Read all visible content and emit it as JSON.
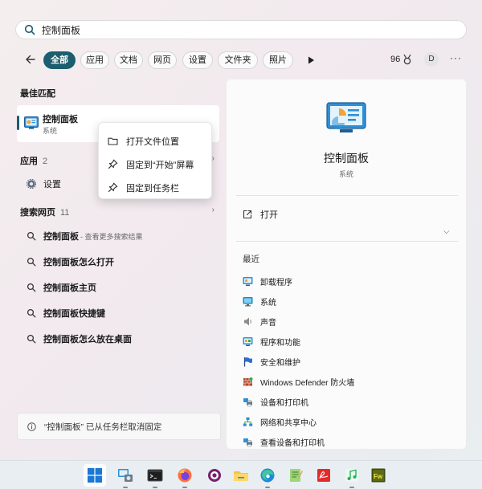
{
  "search": {
    "value": "控制面板"
  },
  "filters": {
    "tabs": [
      "全部",
      "应用",
      "文档",
      "网页",
      "设置",
      "文件夹",
      "照片"
    ],
    "points": "96",
    "avatar_letter": "D",
    "more": "···"
  },
  "best_match": {
    "section": "最佳匹配",
    "title": "控制面板",
    "subtitle": "系统"
  },
  "apps": {
    "section": "应用",
    "count": "2",
    "items": [
      "设置"
    ]
  },
  "web": {
    "section": "搜索网页",
    "count": "11",
    "first_query": "控制面板",
    "first_hint": " - 查看更多搜索结果",
    "suggestions": [
      "控制面板怎么打开",
      "控制面板主页",
      "控制面板快捷键",
      "控制面板怎么放在桌面"
    ]
  },
  "context_menu": {
    "items": [
      "打开文件位置",
      "固定到“开始”屏幕",
      "固定到任务栏"
    ]
  },
  "toast": {
    "text": "“控制面板” 已从任务栏取消固定"
  },
  "detail": {
    "title": "控制面板",
    "subtitle": "系统",
    "open_label": "打开",
    "recent_label": "最近",
    "recent_items": [
      {
        "label": "卸载程序",
        "icon": "control-panel-icon"
      },
      {
        "label": "系统",
        "icon": "monitor-icon"
      },
      {
        "label": "声音",
        "icon": "speaker-icon"
      },
      {
        "label": "程序和功能",
        "icon": "programs-icon"
      },
      {
        "label": "安全和维护",
        "icon": "flag-icon"
      },
      {
        "label": "Windows Defender 防火墙",
        "icon": "firewall-icon"
      },
      {
        "label": "设备和打印机",
        "icon": "printer-icon"
      },
      {
        "label": "网络和共享中心",
        "icon": "network-icon"
      },
      {
        "label": "查看设备和打印机",
        "icon": "printer-icon"
      }
    ]
  },
  "taskbar": {
    "icons": [
      "windows-start-icon",
      "control-panel-icon",
      "terminal-icon",
      "firefox-icon",
      "media-player-icon",
      "file-explorer-icon",
      "edge-icon",
      "notepad-icon",
      "pdf-icon",
      "music-icon",
      "fireworks-icon"
    ]
  },
  "colors": {
    "accent": "#1a5e6f"
  }
}
